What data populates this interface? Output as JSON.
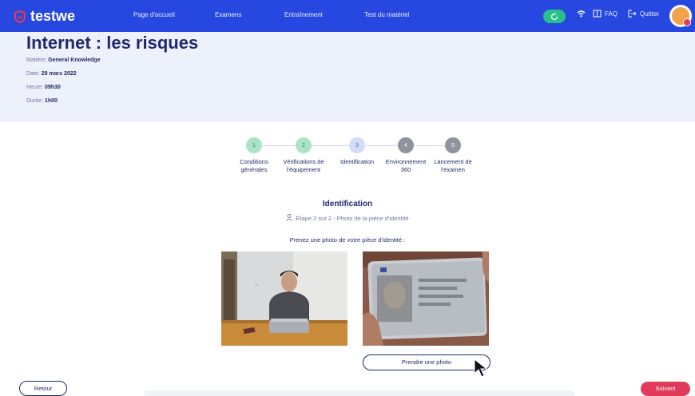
{
  "nav": {
    "logo_text": "testwe",
    "links": [
      "Page d'accueil",
      "Examens",
      "Entraînement",
      "Test du matériel"
    ],
    "faq_label": "FAQ",
    "quit_label": "Quitter"
  },
  "exam": {
    "title": "Internet : les risques",
    "subject_label": "Matière:",
    "subject_value": "General Knowledge",
    "date_label": "Date:",
    "date_value": "29 mars 2022",
    "hour_label": "Heure:",
    "hour_value": "09h30",
    "duration_label": "Durée:",
    "duration_value": "1h00"
  },
  "steps": [
    {
      "number": "1",
      "label": "Conditions générales",
      "state": "done",
      "color": "#a9e4c9",
      "text_color": "#2b8a5e"
    },
    {
      "number": "2",
      "label": "Vérifications de l'équipement",
      "state": "done",
      "color": "#a9e4c9",
      "text_color": "#2b8a5e"
    },
    {
      "number": "3",
      "label": "Identification",
      "state": "current",
      "color": "#d3dcf7",
      "text_color": "#5a6bb0"
    },
    {
      "number": "4",
      "label": "Environnement 360",
      "state": "todo",
      "color": "#8f939c",
      "text_color": "#ffffff"
    },
    {
      "number": "5",
      "label": "Lancement de l'examen",
      "state": "todo",
      "color": "#8f939c",
      "text_color": "#ffffff"
    }
  ],
  "identification": {
    "title": "Identification",
    "substep": "Étape 2 sur 2 - Photo de la pièce d'identité",
    "instruction": "Prenez une photo de votre pièce d'identité :",
    "take_photo_label": "Prendre une photo"
  },
  "footer": {
    "back_label": "Retour",
    "next_label": "Suivant"
  },
  "colors": {
    "brand_blue": "#2748e0",
    "header_bg": "#edf1fb",
    "navy": "#1f2a6b",
    "accent_red": "#e03b5a",
    "sync_green": "#26c28a"
  }
}
